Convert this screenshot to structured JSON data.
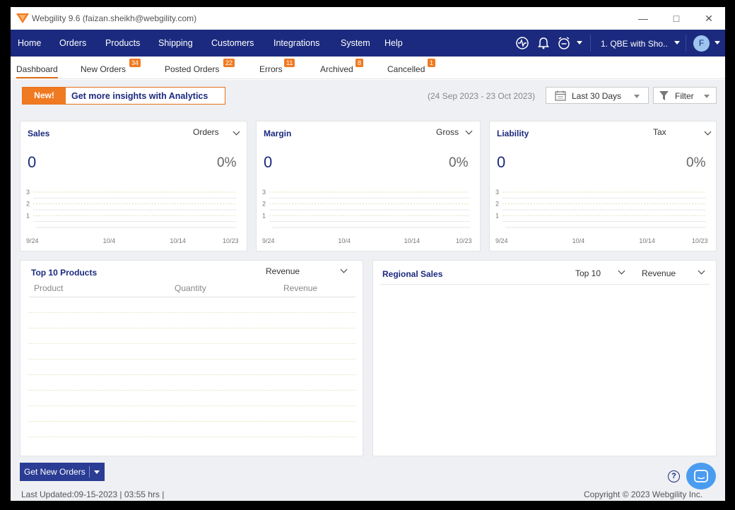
{
  "window": {
    "title": "Webgility 9.6 (faizan.sheikh@webgility.com)"
  },
  "nav": {
    "items": [
      "Home",
      "Orders",
      "Products",
      "Shipping",
      "Customers",
      "Integrations",
      "System",
      "Help"
    ],
    "connection": "1. QBE with Sho..",
    "avatar_initial": "F"
  },
  "tabs": [
    {
      "label": "Dashboard",
      "badge": ""
    },
    {
      "label": "New Orders",
      "badge": "34"
    },
    {
      "label": "Posted Orders",
      "badge": "22"
    },
    {
      "label": "Errors",
      "badge": "11"
    },
    {
      "label": "Archived",
      "badge": "8"
    },
    {
      "label": "Cancelled",
      "badge": "1"
    }
  ],
  "promo": {
    "tag": "New!",
    "text": "Get more insights with Analytics"
  },
  "filters": {
    "date_range": "(24 Sep 2023 - 23 Oct 2023)",
    "period": "Last 30 Days",
    "filter_label": "Filter"
  },
  "cards": [
    {
      "title": "Sales",
      "dropdown": "Orders",
      "value": "0",
      "percent": "0%"
    },
    {
      "title": "Margin",
      "dropdown": "Gross",
      "value": "0",
      "percent": "0%"
    },
    {
      "title": "Liability",
      "dropdown": "Tax",
      "value": "0",
      "percent": "0%"
    }
  ],
  "chart_data": {
    "type": "line",
    "x": [
      "9/24",
      "10/4",
      "10/14",
      "10/23"
    ],
    "y_ticks": [
      "3",
      "2",
      "1"
    ],
    "ylim": [
      0,
      3
    ],
    "series": [
      {
        "values": [
          0,
          0,
          0,
          0
        ]
      }
    ]
  },
  "top_products": {
    "title": "Top 10 Products",
    "dropdown": "Revenue",
    "columns": [
      "Product",
      "Quantity",
      "Revenue"
    ]
  },
  "regional": {
    "title": "Regional Sales",
    "dropdown_top": "Top 10",
    "dropdown_metric": "Revenue"
  },
  "actions": {
    "get_orders": "Get New Orders",
    "help": "?"
  },
  "footer": {
    "last_updated": "Last Updated:09-15-2023 | 03:55 hrs |",
    "copyright": "Copyright © 2023 Webgility Inc."
  },
  "colors": {
    "nav_bg": "#1b2a7e",
    "accent": "#f07a22",
    "chat": "#4a9cf0"
  }
}
